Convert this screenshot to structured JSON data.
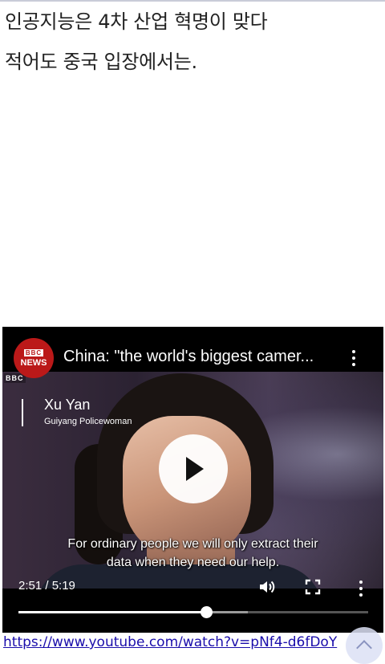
{
  "post": {
    "line1": "인공지능은 4차 산업 혁명이 맞다",
    "line2": "적어도 중국 입장에서는."
  },
  "video": {
    "channel_logo_top": "BBC",
    "channel_logo_bottom": "NEWS",
    "title": "China: \"the world's biggest camer...",
    "watermark": "BBC",
    "lower_third_name": "Xu Yan",
    "lower_third_title": "Guiyang Policewoman",
    "subtitle_line1": "For ordinary people we will only extract their",
    "subtitle_line2": "data when they need our help.",
    "time_display": "2:51 / 5:19",
    "progress_fraction": 0.536,
    "buffered_fraction": 0.655,
    "icons": [
      "play-icon",
      "volume-icon",
      "fullscreen-icon",
      "more-icon"
    ]
  },
  "link": {
    "url": "https://www.youtube.com/watch?v=pNf4-d6fDoY"
  },
  "colors": {
    "link": "#1a0dab",
    "bbc_red": "#bb1919"
  }
}
